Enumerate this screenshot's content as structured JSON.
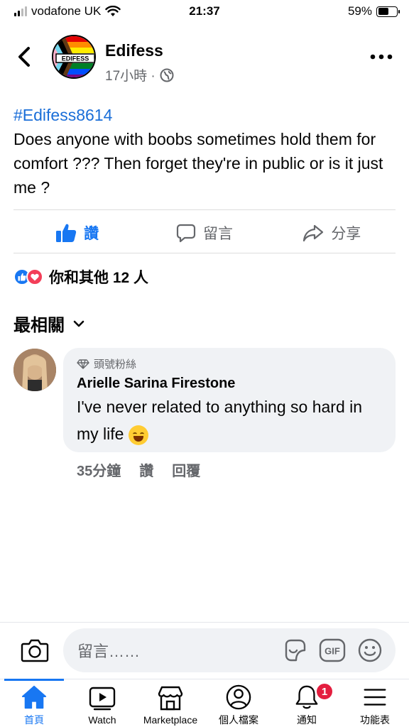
{
  "status_bar": {
    "carrier": "vodafone UK",
    "time": "21:37",
    "battery": "59%"
  },
  "header": {
    "page_name": "Edifess",
    "post_time": "17小時 ·",
    "logo_text": "EDIFESS"
  },
  "post": {
    "hashtag": "#Edifess8614",
    "text": "Does anyone with boobs sometimes hold them for comfort ??? Then forget they're in public or is it just me ?"
  },
  "actions": {
    "like": "讚",
    "comment": "留言",
    "share": "分享"
  },
  "reactions": {
    "summary": "你和其他 12 人"
  },
  "sort": {
    "label": "最相關"
  },
  "comment": {
    "badge": "頭號粉絲",
    "author": "Arielle Sarina Firestone",
    "text": "I've never related to anything so hard in my life",
    "time": "35分鐘",
    "like": "讚",
    "reply": "回覆"
  },
  "composer": {
    "placeholder": "留言……"
  },
  "tabs": [
    {
      "label": "首頁",
      "icon": "home-icon",
      "active": true
    },
    {
      "label": "Watch",
      "icon": "watch-icon"
    },
    {
      "label": "Marketplace",
      "icon": "marketplace-icon"
    },
    {
      "label": "個人檔案",
      "icon": "profile-icon"
    },
    {
      "label": "通知",
      "icon": "bell-icon",
      "badge": "1"
    },
    {
      "label": "功能表",
      "icon": "menu-icon"
    }
  ],
  "colors": {
    "accent": "#1877f2",
    "notification": "#e41e3f",
    "hashtag": "#1a6ed8"
  }
}
